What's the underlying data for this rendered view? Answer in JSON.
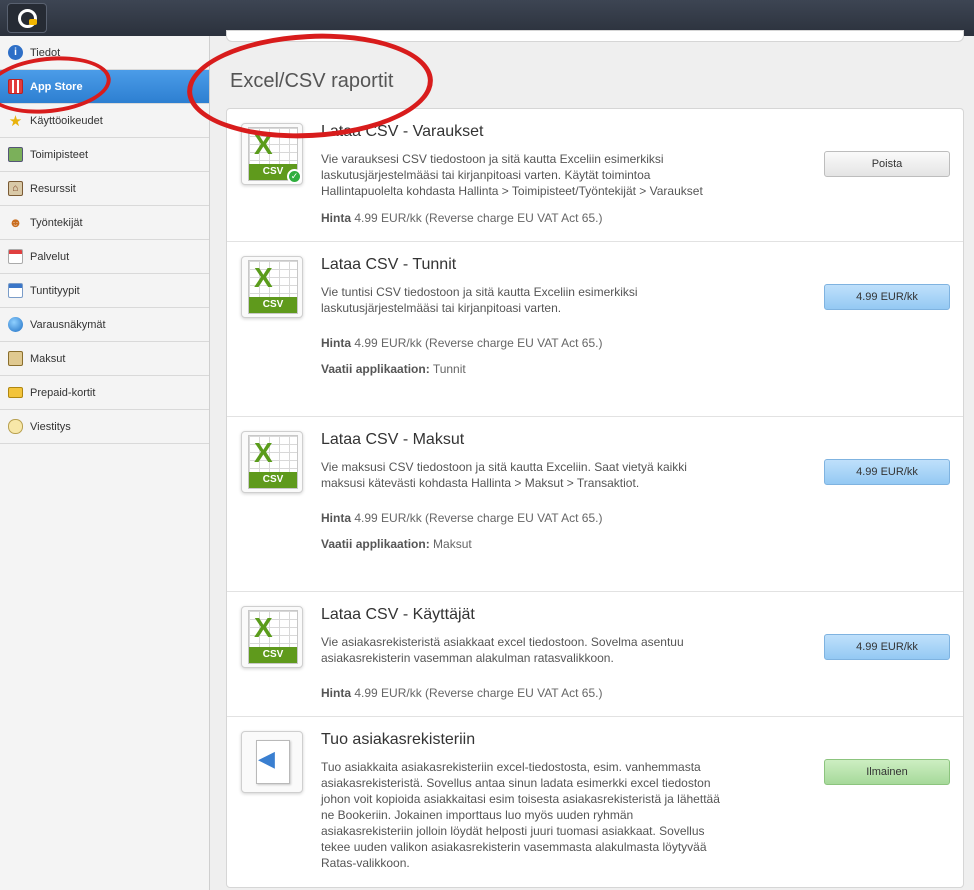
{
  "nav": [
    {
      "label": "Tiedot",
      "icon": "info-icon"
    },
    {
      "label": "App Store",
      "icon": "store-icon"
    },
    {
      "label": "Käyttöoikeudet",
      "icon": "star-icon"
    },
    {
      "label": "Toimipisteet",
      "icon": "location-icon"
    },
    {
      "label": "Resurssit",
      "icon": "house-icon"
    },
    {
      "label": "Työntekijät",
      "icon": "users-icon"
    },
    {
      "label": "Palvelut",
      "icon": "calendar-icon"
    },
    {
      "label": "Tuntityypit",
      "icon": "calendar-grid-icon"
    },
    {
      "label": "Varausnäkymät",
      "icon": "globe-icon"
    },
    {
      "label": "Maksut",
      "icon": "payment-icon"
    },
    {
      "label": "Prepaid-kortit",
      "icon": "card-icon"
    },
    {
      "label": "Viestitys",
      "icon": "chat-icon"
    }
  ],
  "section_title": "Excel/CSV raportit",
  "labels": {
    "price": "Hinta",
    "requires": "Vaatii applikaation:",
    "csv": "CSV"
  },
  "apps": [
    {
      "title": "Lataa CSV - Varaukset",
      "description": "Vie varauksesi CSV tiedostoon ja sitä kautta Exceliin esimerkiksi laskutusjärjestelmääsi tai kirjanpitoasi varten. Käytät toimintoa Hallintapuolelta kohdasta Hallinta > Toimipisteet/Työntekijät > Varaukset",
      "price": "4.99 EUR/kk (Reverse charge EU VAT Act 65.)",
      "requires": "",
      "button": "Poista",
      "installed": true
    },
    {
      "title": "Lataa CSV - Tunnit",
      "description": "Vie tuntisi CSV tiedostoon ja sitä kautta Exceliin esimerkiksi laskutusjärjestelmääsi tai kirjanpitoasi varten.",
      "price": "4.99 EUR/kk (Reverse charge EU VAT Act 65.)",
      "requires": "Tunnit",
      "button": "4.99 EUR/kk"
    },
    {
      "title": "Lataa CSV - Maksut",
      "description": "Vie maksusi CSV tiedostoon ja sitä kautta Exceliin. Saat vietyä kaikki maksusi kätevästi kohdasta Hallinta > Maksut > Transaktiot.",
      "price": "4.99 EUR/kk (Reverse charge EU VAT Act 65.)",
      "requires": "Maksut",
      "button": "4.99 EUR/kk"
    },
    {
      "title": "Lataa CSV - Käyttäjät",
      "description": "Vie asiakasrekisteristä asiakkaat excel tiedostoon. Sovelma asentuu asiakasrekisterin vasemman alakulman ratasvalikkoon.",
      "price": "4.99 EUR/kk (Reverse charge EU VAT Act 65.)",
      "requires": "",
      "button": "4.99 EUR/kk"
    },
    {
      "title": "Tuo asiakasrekisteriin",
      "description": "Tuo asiakkaita asiakasrekisteriin excel-tiedostosta, esim. vanhemmasta asiakasrekisteristä. Sovellus antaa sinun ladata esimerkki excel tiedoston johon voit kopioida asiakkaitasi esim toisesta asiakasrekisteristä ja lähettää ne Bookeriin. Jokainen importtaus luo myös uuden ryhmän asiakasrekisteriin jolloin löydät helposti juuri tuomasi asiakkaat. Sovellus tekee uuden valikon asiakasrekisterin vasemmasta alakulmasta löytyvää Ratas-valikkoon.",
      "price": "",
      "requires": "",
      "button": "Ilmainen"
    }
  ]
}
